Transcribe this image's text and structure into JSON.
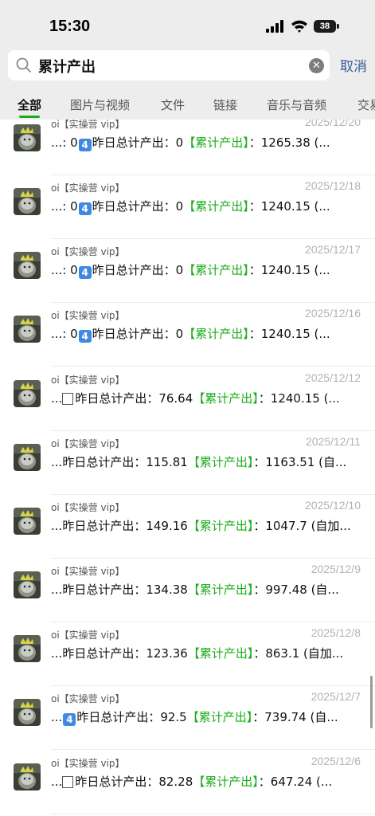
{
  "status": {
    "time": "15:30",
    "battery": "38"
  },
  "search": {
    "query": "累计产出",
    "cancel_label": "取消"
  },
  "tabs": [
    {
      "label": "全部",
      "active": true
    },
    {
      "label": "图片与视频"
    },
    {
      "label": "文件"
    },
    {
      "label": "链接"
    },
    {
      "label": "音乐与音频"
    },
    {
      "label": "交易"
    }
  ],
  "results": [
    {
      "sender": "oi【实操营 vip】",
      "date": "2025/12/20",
      "pre": "...: 0",
      "mark": "4",
      "mid": "昨日总计产出：0",
      "tag": "【累计产出】",
      "post": "：1265.38 (..."
    },
    {
      "sender": "oi【实操营 vip】",
      "date": "2025/12/18",
      "pre": "...: 0",
      "mark": "4",
      "mid": "昨日总计产出：0",
      "tag": "【累计产出】",
      "post": "：1240.15 (..."
    },
    {
      "sender": "oi【实操营 vip】",
      "date": "2025/12/17",
      "pre": "...: 0",
      "mark": "4",
      "mid": "昨日总计产出：0",
      "tag": "【累计产出】",
      "post": "：1240.15 (..."
    },
    {
      "sender": "oi【实操营 vip】",
      "date": "2025/12/16",
      "pre": "...: 0",
      "mark": "4",
      "mid": "昨日总计产出：0",
      "tag": "【累计产出】",
      "post": "：1240.15 (..."
    },
    {
      "sender": "oi【实操营 vip】",
      "date": "2025/12/12",
      "pre": "...",
      "mark": "box",
      "mid": "昨日总计产出：76.64",
      "tag": "【累计产出】",
      "post": "：1240.15 (..."
    },
    {
      "sender": "oi【实操营 vip】",
      "date": "2025/12/11",
      "pre": "...",
      "mark": "",
      "mid": "昨日总计产出：115.81",
      "tag": "【累计产出】",
      "post": "：1163.51 (自..."
    },
    {
      "sender": "oi【实操营 vip】",
      "date": "2025/12/10",
      "pre": "...",
      "mark": "",
      "mid": "昨日总计产出：149.16",
      "tag": "【累计产出】",
      "post": "：1047.7 (自加..."
    },
    {
      "sender": "oi【实操营 vip】",
      "date": "2025/12/9",
      "pre": "...",
      "mark": "",
      "mid": "昨日总计产出：134.38",
      "tag": "【累计产出】",
      "post": "：997.48 (自..."
    },
    {
      "sender": "oi【实操营 vip】",
      "date": "2025/12/8",
      "pre": "...",
      "mark": "",
      "mid": "昨日总计产出：123.36",
      "tag": "【累计产出】",
      "post": "：863.1 (自加..."
    },
    {
      "sender": "oi【实操营 vip】",
      "date": "2025/12/7",
      "pre": "...",
      "mark": "4",
      "mid": "昨日总计产出：92.5",
      "tag": "【累计产出】",
      "post": "：739.74 (自..."
    },
    {
      "sender": "oi【实操营 vip】",
      "date": "2025/12/6",
      "pre": "...",
      "mark": "box",
      "mid": "昨日总计产出：82.28",
      "tag": "【累计产出】",
      "post": "：647.24 (..."
    }
  ],
  "colors": {
    "accent": "#1aad19",
    "link": "#3b5a96",
    "date": "#b2b2b2"
  }
}
